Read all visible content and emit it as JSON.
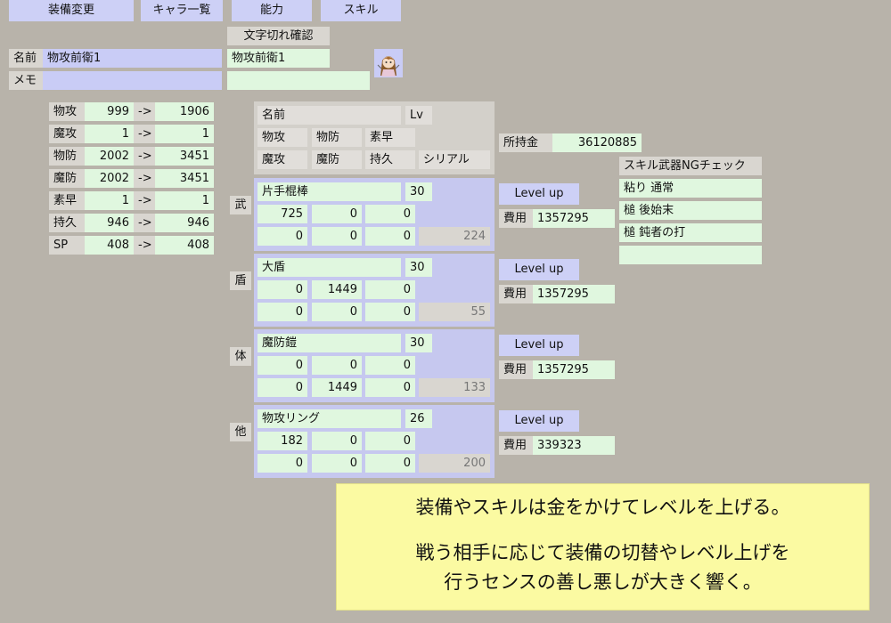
{
  "top_tabs": [
    "装備変更",
    "キャラ一覧",
    "能力",
    "スキル"
  ],
  "check_button": "文字切れ確認",
  "name_label": "名前",
  "name_value": "物攻前衛1",
  "name_value_2": "物攻前衛1",
  "memo_label": "メモ",
  "memo_value": "",
  "memo_value_2": "",
  "stats": [
    {
      "label": "物攻",
      "from": "999",
      "arrow": "->",
      "to": "1906"
    },
    {
      "label": "魔攻",
      "from": "1",
      "arrow": "->",
      "to": "1"
    },
    {
      "label": "物防",
      "from": "2002",
      "arrow": "->",
      "to": "3451"
    },
    {
      "label": "魔防",
      "from": "2002",
      "arrow": "->",
      "to": "3451"
    },
    {
      "label": "素早",
      "from": "1",
      "arrow": "->",
      "to": "1"
    },
    {
      "label": "持久",
      "from": "946",
      "arrow": "->",
      "to": "946"
    },
    {
      "label": "SP",
      "from": "408",
      "arrow": "->",
      "to": "408"
    }
  ],
  "header_panel": {
    "name_label": "名前",
    "lv_label": "Lv",
    "row1": [
      "物攻",
      "物防",
      "素早"
    ],
    "row2": [
      "魔攻",
      "魔防",
      "持久",
      "シリアル"
    ]
  },
  "gold_label": "所持金",
  "gold_value": "36120885",
  "equipment": [
    {
      "slot": "武",
      "name": "片手棍棒",
      "lv": "30",
      "row1": [
        "725",
        "0",
        "0"
      ],
      "row2": [
        "0",
        "0",
        "0"
      ],
      "serial": "224",
      "levelup": "Level up",
      "cost_label": "費用",
      "cost": "1357295"
    },
    {
      "slot": "盾",
      "name": "大盾",
      "lv": "30",
      "row1": [
        "0",
        "1449",
        "0"
      ],
      "row2": [
        "0",
        "0",
        "0"
      ],
      "serial": "55",
      "levelup": "Level up",
      "cost_label": "費用",
      "cost": "1357295"
    },
    {
      "slot": "体",
      "name": "魔防鎧",
      "lv": "30",
      "row1": [
        "0",
        "0",
        "0"
      ],
      "row2": [
        "0",
        "1449",
        "0"
      ],
      "serial": "133",
      "levelup": "Level up",
      "cost_label": "費用",
      "cost": "1357295"
    },
    {
      "slot": "他",
      "name": "物攻リング",
      "lv": "26",
      "row1": [
        "182",
        "0",
        "0"
      ],
      "row2": [
        "0",
        "0",
        "0"
      ],
      "serial": "200",
      "levelup": "Level up",
      "cost_label": "費用",
      "cost": "339323"
    }
  ],
  "skills": {
    "header": "スキル武器NGチェック",
    "items": [
      "粘り 通常",
      "槌  後始末",
      "槌  鈍者の打",
      ""
    ]
  },
  "note": {
    "line1": "装備やスキルは金をかけてレベルを上げる。",
    "line2": "戦う相手に応じて装備の切替やレベル上げを",
    "line3": "行うセンスの善し悪しが大きく響く。"
  }
}
